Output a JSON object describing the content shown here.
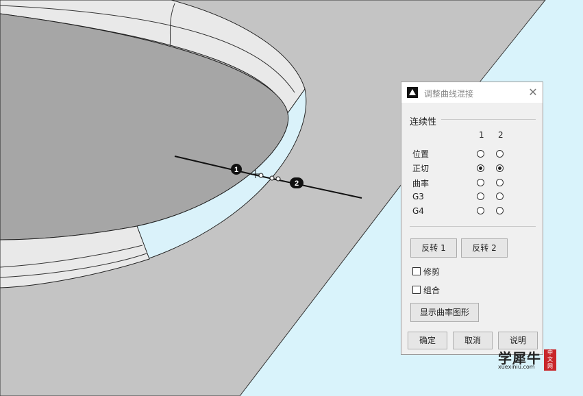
{
  "viewport": {
    "points": {
      "p1_label": "1",
      "p2_label": "2"
    }
  },
  "dialog": {
    "title": "调整曲线混接",
    "close_glyph": "✕",
    "continuity": {
      "label": "连续性",
      "columns": [
        "1",
        "2"
      ],
      "rows": [
        {
          "label": "位置",
          "end1": false,
          "end2": false
        },
        {
          "label": "正切",
          "end1": true,
          "end2": true
        },
        {
          "label": "曲率",
          "end1": false,
          "end2": false
        },
        {
          "label": "G3",
          "end1": false,
          "end2": false
        },
        {
          "label": "G4",
          "end1": false,
          "end2": false
        }
      ]
    },
    "reverse1_label": "反转 1",
    "reverse2_label": "反转 2",
    "trim_label": "修剪",
    "trim_checked": false,
    "join_label": "组合",
    "join_checked": false,
    "show_curvature_label": "显示曲率图形",
    "ok_label": "确定",
    "cancel_label": "取消",
    "help_label": "说明"
  },
  "watermark": {
    "title": "学犀牛",
    "url": "xuexiniu.com",
    "seal": [
      "中",
      "文",
      "网"
    ]
  },
  "colors": {
    "background_gray": "#c4c4c4",
    "cyan_panel": "#d9f3fb",
    "blend_surface": "#daf2fa",
    "inner_hole": "#a6a6a6"
  }
}
